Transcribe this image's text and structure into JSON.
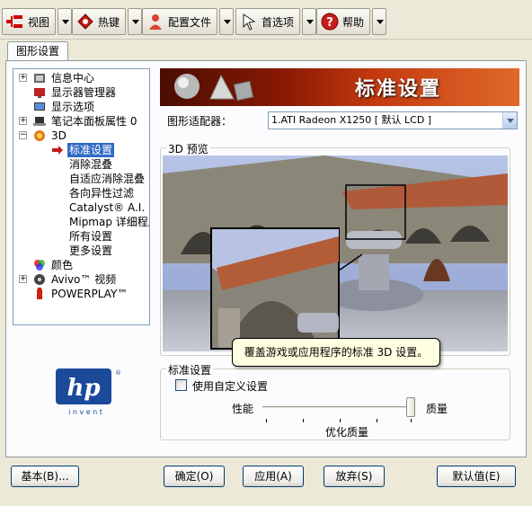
{
  "toolbar": {
    "view_label": "视图",
    "hotkeys_label": "热键",
    "profiles_label": "配置文件",
    "preferences_label": "首选项",
    "help_label": "帮助"
  },
  "tab": {
    "label": "图形设置"
  },
  "tree": {
    "items": [
      {
        "label": "信息中心",
        "icon": "info-center-icon"
      },
      {
        "label": "显示器管理器",
        "icon": "display-manager-icon"
      },
      {
        "label": "显示选项",
        "icon": "display-options-icon"
      },
      {
        "label": "笔记本面板属性 0",
        "icon": "notebook-panel-icon"
      },
      {
        "label": "3D",
        "icon": "3d-icon"
      },
      {
        "label": "标准设置"
      },
      {
        "label": "消除混叠"
      },
      {
        "label": "自适应消除混叠"
      },
      {
        "label": "各向异性过滤"
      },
      {
        "label": "Catalyst® A.I."
      },
      {
        "label": "Mipmap 详细程度"
      },
      {
        "label": "所有设置"
      },
      {
        "label": "更多设置"
      },
      {
        "label": "颜色",
        "icon": "color-icon"
      },
      {
        "label": "Avivo™ 视频",
        "icon": "avivo-video-icon"
      },
      {
        "label": "POWERPLAY™",
        "icon": "powerplay-icon"
      }
    ]
  },
  "banner": {
    "title": "标准设置"
  },
  "adapter": {
    "label": "图形适配器：",
    "value": "1.ATI Radeon X1250 [ 默认 LCD ]"
  },
  "preview": {
    "title": "3D 预览"
  },
  "logo": {
    "brand": "hp",
    "tagline": "i n v e n t"
  },
  "tooltip": {
    "text": "覆盖游戏或应用程序的标准 3D 设置。"
  },
  "standard": {
    "title": "标准设置",
    "custom_checkbox": "使用自定义设置",
    "checked": false,
    "left_label": "性能",
    "right_label": "质量",
    "bottom_label": "优化质量",
    "slider_level": 1.0
  },
  "buttons": {
    "basic": "基本(B)...",
    "ok": "确定(O)",
    "apply": "应用(A)",
    "discard": "放弃(S)",
    "defaults": "默认值(E)"
  },
  "colors": {
    "banner_dark": "#4a0d02",
    "banner_light": "#e06a2a",
    "selection": "#316ac5",
    "hp_blue": "#1b4a9b"
  }
}
